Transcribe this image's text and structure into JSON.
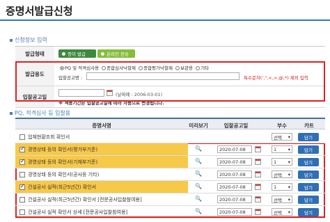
{
  "page": {
    "title": "증명서발급신청"
  },
  "section1": {
    "title": "신청정보 입력"
  },
  "form": {
    "method_label": "발급형태",
    "method_opt1": "종이 발급",
    "method_opt2": "온라인 전송",
    "purpose_label": "발급용도",
    "purpose_opts": [
      "PQ 및 적격심사용",
      "종합심사낙찰제",
      "종합평가낙찰제",
      "보관용",
      "기타"
    ],
    "notice_label": "입찰공고명 :",
    "notice_value": "",
    "special_char_note": "특수문자(',\",<,>,@,*) 제외 입력",
    "date_label": "입찰공고일",
    "date_value": "",
    "date_example": "(날짜예 : 2006-03-01)",
    "date_note": "※ 적용기간은 입찰공고일에 따라 자동으로 변경됩니다."
  },
  "section2": {
    "title": "PQ, 적격심사 등 입찰용"
  },
  "list": {
    "headers": {
      "name": "증명서명",
      "preview": "미리보기",
      "date": "입찰공고일",
      "qty": "부수",
      "cart": "카트"
    },
    "select_label": "선택",
    "cart_label": "담기",
    "rows": [
      {
        "name": "업체현황조회 확인서",
        "checked": false,
        "highlight": false,
        "preview": false,
        "date": "",
        "qty": "선택"
      },
      {
        "name": "경영상태 등의 확인서(평가부기준)",
        "checked": true,
        "highlight": true,
        "preview": true,
        "date": "2020-07-08",
        "qty": "1"
      },
      {
        "name": "경영상태 등의 확인서(기재부기준)",
        "checked": true,
        "highlight": true,
        "preview": true,
        "date": "2020-07-08",
        "qty": "1"
      },
      {
        "name": "경영상태 등의 확인서(공사등 기타)",
        "checked": false,
        "highlight": false,
        "preview": true,
        "date": "2020-07-08",
        "qty": "선택"
      },
      {
        "name": "건설공사 실적(최근5년간) 확인서",
        "checked": true,
        "highlight": true,
        "preview": true,
        "date": "2020-07-08",
        "qty": "1"
      },
      {
        "name": "건설공사 실적(최근5년간) 확인서 [전문공사입찰참여용]",
        "checked": false,
        "highlight": false,
        "preview": true,
        "date": "2020-07-08",
        "qty": "선택"
      },
      {
        "name": "건설공사 실적 확인서 상세 [전문공사입찰참여용]",
        "checked": false,
        "highlight": false,
        "preview": true,
        "date": "2020-07-08",
        "qty": "선택"
      }
    ]
  },
  "colors": {
    "accent_blue": "#2c76c2",
    "highlight_yellow": "#f7c948",
    "annotation_red": "#e02020",
    "btn_green_dark": "#3d8a3d",
    "btn_green_light": "#84be3a"
  }
}
